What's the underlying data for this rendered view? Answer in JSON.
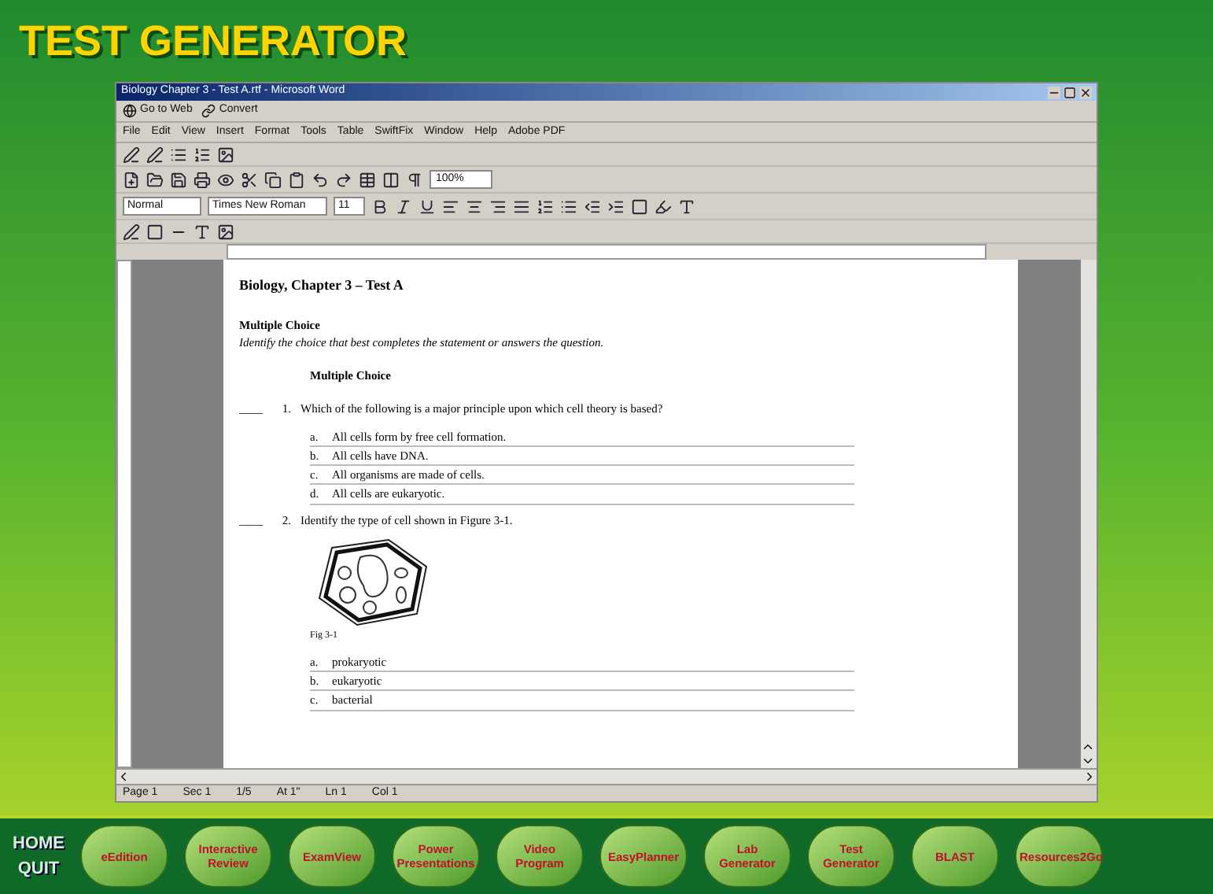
{
  "app_title": "TEST GENERATOR",
  "word": {
    "title": "Biology Chapter 3 - Test A.rtf - Microsoft Word",
    "link_toolbar": [
      "Go to Web",
      "Convert"
    ],
    "menu": [
      "File",
      "Edit",
      "View",
      "Insert",
      "Format",
      "Tools",
      "Table",
      "SwiftFix",
      "Window",
      "Help",
      "Adobe PDF"
    ],
    "style": "Normal",
    "font": "Times New Roman",
    "size": "11",
    "zoom": "100%"
  },
  "document": {
    "title": "Biology, Chapter 3 – Test A",
    "section": "Multiple Choice",
    "instructions": "Identify the choice that best completes the statement or answers the question.",
    "subheading": "Multiple Choice",
    "questions": [
      {
        "blank": "____",
        "number": "1.",
        "text": "Which of the following is a major principle upon which cell theory is based?",
        "choices": [
          {
            "letter": "a.",
            "text": "All cells form by free cell formation."
          },
          {
            "letter": "b.",
            "text": "All cells have DNA."
          },
          {
            "letter": "c.",
            "text": "All organisms are made of cells."
          },
          {
            "letter": "d.",
            "text": "All cells are eukaryotic."
          }
        ]
      },
      {
        "blank": "____",
        "number": "2.",
        "text": "Identify the type of cell shown in Figure 3-1.",
        "figure": {
          "caption": "Fig 3-1"
        },
        "choices": [
          {
            "letter": "a.",
            "text": "prokaryotic"
          },
          {
            "letter": "b.",
            "text": "eukaryotic"
          },
          {
            "letter": "c.",
            "text": "bacterial"
          }
        ]
      }
    ]
  },
  "status_bar": [
    "Page 1",
    "Sec 1",
    "1/5",
    "At 1\"",
    "Ln 1",
    "Col 1"
  ],
  "nav": {
    "side": [
      "HOME",
      "QUIT"
    ],
    "buttons": [
      "eEdition",
      "Interactive Review",
      "ExamView",
      "Power Presentations",
      "Video Program",
      "EasyPlanner",
      "Lab Generator",
      "Test Generator",
      "BLAST",
      "Resources2Go"
    ]
  }
}
